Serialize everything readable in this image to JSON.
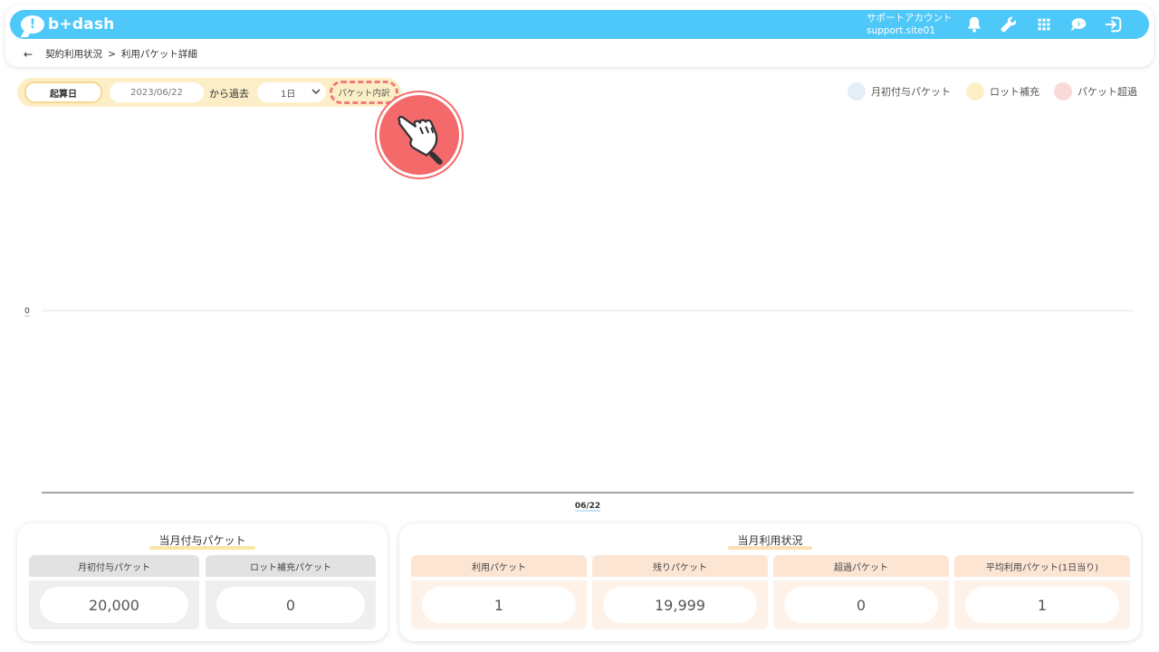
{
  "header": {
    "logo_text": "b+dash",
    "logo_mark": "!",
    "account_label": "サポートアカウント",
    "account_name": "support.site01",
    "icons": [
      "bell-icon",
      "wrench-icon",
      "grid-icon",
      "chat-icon",
      "logout-icon"
    ]
  },
  "breadcrumb": {
    "back": "←",
    "parent": "契約利用状況",
    "separator": ">",
    "current": "利用パケット詳細"
  },
  "filter": {
    "start_button": "起算日",
    "date_value": "2023/06/22",
    "from_past": "から過去",
    "period_value": "1日",
    "packet_button": "パケット内訳"
  },
  "legend": [
    {
      "label": "月初付与パケット",
      "color": "#e3eef9"
    },
    {
      "label": "ロット補充",
      "color": "#fcefc7"
    },
    {
      "label": "パケット超過",
      "color": "#fcd9d9"
    }
  ],
  "chart_data": {
    "type": "bar",
    "categories": [
      "06/22"
    ],
    "series": [
      {
        "name": "月初付与パケット",
        "values": [
          0
        ]
      },
      {
        "name": "ロット補充",
        "values": [
          0
        ]
      },
      {
        "name": "パケット超過",
        "values": [
          0
        ]
      }
    ],
    "y_tick_labels": [
      "0"
    ],
    "grid": true,
    "legend_placement": "top-right"
  },
  "monthly_grant": {
    "title": "当月付与パケット",
    "cells": [
      {
        "label": "月初付与パケット",
        "value": "20,000"
      },
      {
        "label": "ロット補充パケット",
        "value": "0"
      }
    ]
  },
  "monthly_usage": {
    "title": "当月利用状況",
    "cells": [
      {
        "label": "利用パケット",
        "value": "1"
      },
      {
        "label": "残りパケット",
        "value": "19,999"
      },
      {
        "label": "超過パケット",
        "value": "0"
      },
      {
        "label": "平均利用パケット(1日当り)",
        "value": "1"
      }
    ]
  }
}
